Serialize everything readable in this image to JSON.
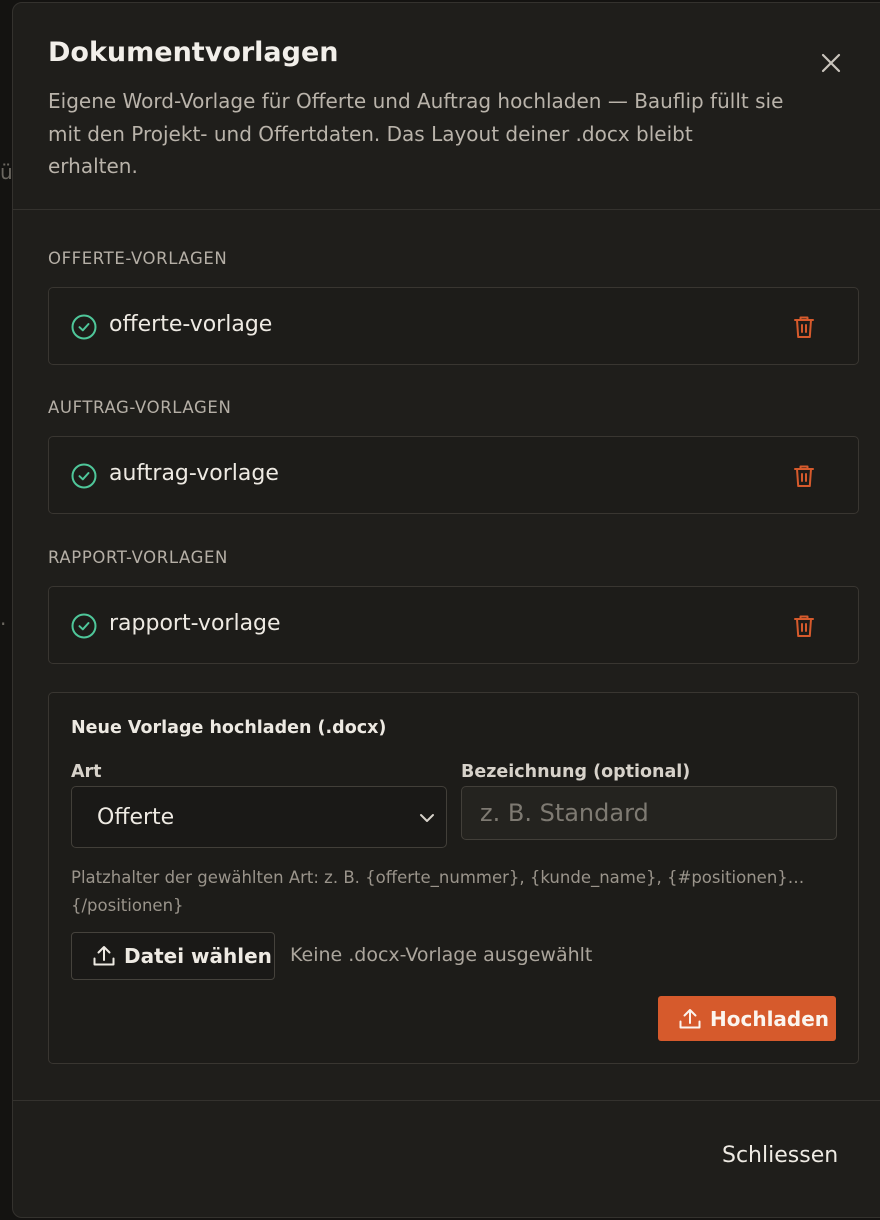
{
  "dialog": {
    "title": "Dokumentvorlagen",
    "subtitle": "Eigene Word-Vorlage für Offerte und Auftrag hochladen — Bauflip füllt sie mit den Projekt- und Offertdaten. Das Layout deiner .docx bleibt erhalten.",
    "close_icon": "close-icon"
  },
  "sections": [
    {
      "label": "OFFERTE-VORLAGEN",
      "template": "offerte-vorlage"
    },
    {
      "label": "AUFTRAG-VORLAGEN",
      "template": "auftrag-vorlage"
    },
    {
      "label": "RAPPORT-VORLAGEN",
      "template": "rapport-vorlage"
    }
  ],
  "upload": {
    "title": "Neue Vorlage hochladen (.docx)",
    "art_label": "Art",
    "art_value": "Offerte",
    "name_label": "Bezeichnung (optional)",
    "name_placeholder": "z. B. Standard",
    "name_value": "",
    "hint": "Platzhalter der gewählten Art: z. B. {offerte_nummer}, {kunde_name}, {#positionen}…{/positionen}",
    "file_button": "Datei wählen",
    "file_status": "Keine .docx-Vorlage ausgewählt",
    "upload_button": "Hochladen"
  },
  "footer": {
    "close_button": "Schliessen"
  },
  "colors": {
    "accent": "#D65A2C",
    "success": "#4FC79A",
    "danger": "#D65A2C"
  }
}
